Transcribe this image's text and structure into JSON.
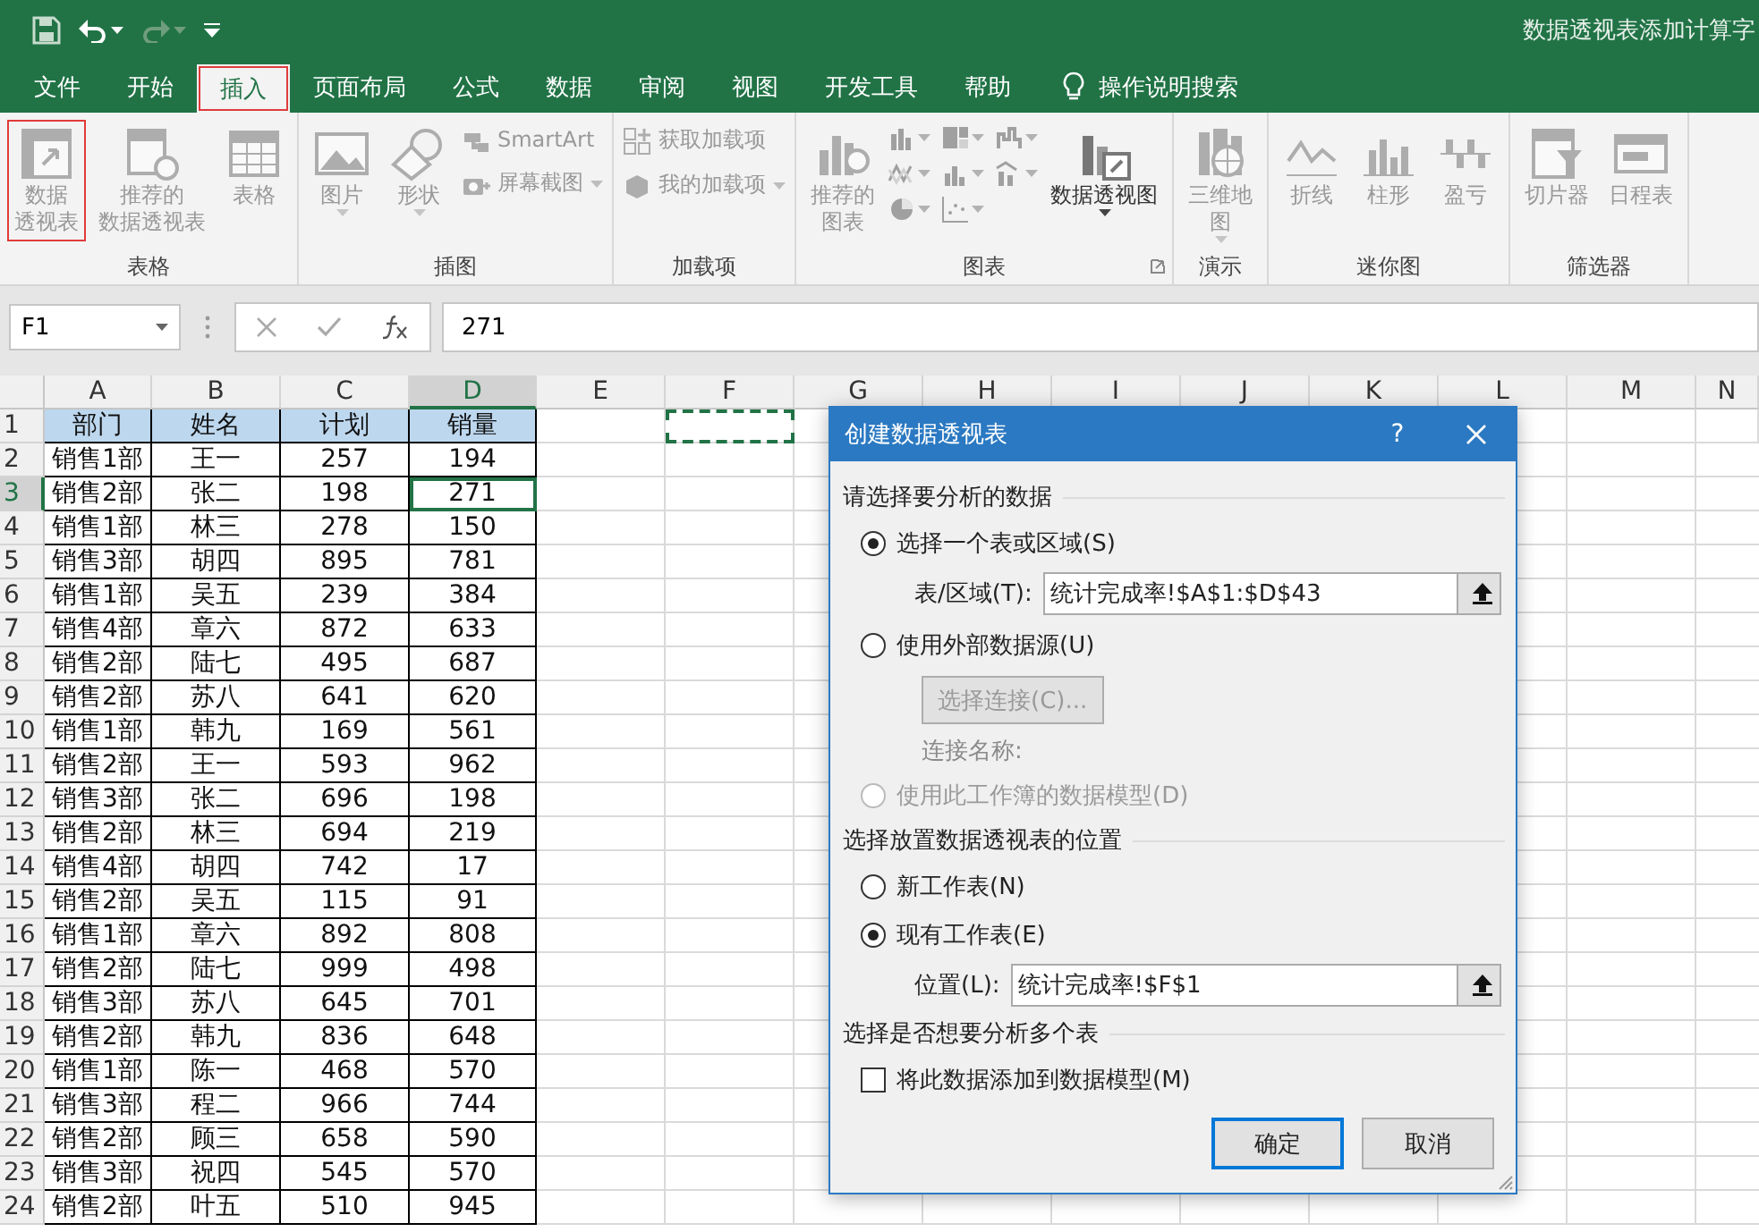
{
  "title_bar": {
    "title": "数据透视表添加计算字"
  },
  "ribbon_tabs": [
    {
      "label": "文件",
      "selected": false
    },
    {
      "label": "开始",
      "selected": false
    },
    {
      "label": "插入",
      "selected": true
    },
    {
      "label": "页面布局",
      "selected": false
    },
    {
      "label": "公式",
      "selected": false
    },
    {
      "label": "数据",
      "selected": false
    },
    {
      "label": "审阅",
      "selected": false
    },
    {
      "label": "视图",
      "selected": false
    },
    {
      "label": "开发工具",
      "selected": false
    },
    {
      "label": "帮助",
      "selected": false
    }
  ],
  "tell_me": "操作说明搜索",
  "ribbon_groups": [
    {
      "label": "表格",
      "items": [
        {
          "kind": "large",
          "lines": [
            "数据",
            "透视表"
          ],
          "highlighted": true,
          "disabled": true,
          "dropdown": false
        },
        {
          "kind": "large",
          "lines": [
            "推荐的",
            "数据透视表"
          ],
          "highlighted": false,
          "disabled": true,
          "dropdown": false
        },
        {
          "kind": "large",
          "lines": [
            "表格"
          ],
          "highlighted": false,
          "disabled": true,
          "dropdown": false
        }
      ]
    },
    {
      "label": "插图",
      "items": [
        {
          "kind": "large",
          "lines": [
            "图片"
          ],
          "highlighted": false,
          "disabled": true,
          "dropdown": true
        },
        {
          "kind": "large",
          "lines": [
            "形状"
          ],
          "highlighted": false,
          "disabled": true,
          "dropdown": true
        },
        {
          "kind": "small",
          "lines": [
            "SmartArt"
          ],
          "highlighted": false,
          "disabled": true,
          "dropdown": false
        },
        {
          "kind": "small",
          "lines": [
            "屏幕截图"
          ],
          "highlighted": false,
          "disabled": true,
          "dropdown": true
        }
      ]
    },
    {
      "label": "加载项",
      "items": [
        {
          "kind": "small",
          "lines": [
            "获取加载项"
          ],
          "highlighted": false,
          "disabled": true,
          "dropdown": false
        },
        {
          "kind": "small",
          "lines": [
            "我的加载项"
          ],
          "highlighted": false,
          "disabled": true,
          "dropdown": true
        }
      ]
    },
    {
      "label": "图表",
      "items": [
        {
          "kind": "large",
          "lines": [
            "推荐的",
            "图表"
          ],
          "highlighted": false,
          "disabled": true,
          "dropdown": false
        },
        {
          "kind": "gallery",
          "highlighted": false,
          "disabled": true,
          "dropdown": true
        },
        {
          "kind": "large",
          "lines": [
            "数据透视图"
          ],
          "highlighted": false,
          "disabled": false,
          "dropdown": true
        },
        {
          "kind": "launcher",
          "highlighted": false,
          "disabled": false,
          "dropdown": false
        }
      ]
    },
    {
      "label": "演示",
      "items": [
        {
          "kind": "large",
          "lines": [
            "三维地",
            "图"
          ],
          "highlighted": false,
          "disabled": true,
          "dropdown": true
        }
      ]
    },
    {
      "label": "迷你图",
      "items": [
        {
          "kind": "large",
          "lines": [
            "折线"
          ],
          "highlighted": false,
          "disabled": true,
          "dropdown": false
        },
        {
          "kind": "large",
          "lines": [
            "柱形"
          ],
          "highlighted": false,
          "disabled": true,
          "dropdown": false
        },
        {
          "kind": "large",
          "lines": [
            "盈亏"
          ],
          "highlighted": false,
          "disabled": true,
          "dropdown": false
        }
      ]
    },
    {
      "label": "筛选器",
      "items": [
        {
          "kind": "large",
          "lines": [
            "切片器"
          ],
          "highlighted": false,
          "disabled": true,
          "dropdown": false
        },
        {
          "kind": "large",
          "lines": [
            "日程表"
          ],
          "highlighted": false,
          "disabled": true,
          "dropdown": false
        }
      ]
    }
  ],
  "formula_bar": {
    "name_box": "F1",
    "value": "271"
  },
  "sheet": {
    "columns": [
      {
        "label": "A",
        "selected": false,
        "marquee": false
      },
      {
        "label": "B",
        "selected": false,
        "marquee": false
      },
      {
        "label": "C",
        "selected": false,
        "marquee": false
      },
      {
        "label": "D",
        "selected": true,
        "marquee": false
      },
      {
        "label": "E",
        "selected": false,
        "marquee": false
      },
      {
        "label": "F",
        "selected": false,
        "marquee": true
      },
      {
        "label": "G",
        "selected": false,
        "marquee": false
      },
      {
        "label": "H",
        "selected": false,
        "marquee": false
      },
      {
        "label": "I",
        "selected": false,
        "marquee": false
      },
      {
        "label": "J",
        "selected": false,
        "marquee": false
      },
      {
        "label": "K",
        "selected": false,
        "marquee": false
      },
      {
        "label": "L",
        "selected": false,
        "marquee": false
      },
      {
        "label": "M",
        "selected": false,
        "marquee": false
      },
      {
        "label": "N",
        "selected": false,
        "marquee": false
      }
    ],
    "rows": [
      {
        "header": "1",
        "kind": "header",
        "selected": false,
        "cells": [
          "部门",
          "姓名",
          "计划",
          "销量"
        ]
      },
      {
        "header": "2",
        "kind": "data",
        "selected": false,
        "cells": [
          "销售1部",
          "王一",
          "257",
          "194"
        ]
      },
      {
        "header": "3",
        "kind": "data",
        "selected": true,
        "cells": [
          "销售2部",
          "张二",
          "198",
          "271"
        ]
      },
      {
        "header": "4",
        "kind": "data",
        "selected": false,
        "cells": [
          "销售1部",
          "林三",
          "278",
          "150"
        ]
      },
      {
        "header": "5",
        "kind": "data",
        "selected": false,
        "cells": [
          "销售3部",
          "胡四",
          "895",
          "781"
        ]
      },
      {
        "header": "6",
        "kind": "data",
        "selected": false,
        "cells": [
          "销售1部",
          "吴五",
          "239",
          "384"
        ]
      },
      {
        "header": "7",
        "kind": "data",
        "selected": false,
        "cells": [
          "销售4部",
          "章六",
          "872",
          "633"
        ]
      },
      {
        "header": "8",
        "kind": "data",
        "selected": false,
        "cells": [
          "销售2部",
          "陆七",
          "495",
          "687"
        ]
      },
      {
        "header": "9",
        "kind": "data",
        "selected": false,
        "cells": [
          "销售2部",
          "苏八",
          "641",
          "620"
        ]
      },
      {
        "header": "10",
        "kind": "data",
        "selected": false,
        "cells": [
          "销售1部",
          "韩九",
          "169",
          "561"
        ]
      },
      {
        "header": "11",
        "kind": "data",
        "selected": false,
        "cells": [
          "销售2部",
          "王一",
          "593",
          "962"
        ]
      },
      {
        "header": "12",
        "kind": "data",
        "selected": false,
        "cells": [
          "销售3部",
          "张二",
          "696",
          "198"
        ]
      },
      {
        "header": "13",
        "kind": "data",
        "selected": false,
        "cells": [
          "销售2部",
          "林三",
          "694",
          "219"
        ]
      },
      {
        "header": "14",
        "kind": "data",
        "selected": false,
        "cells": [
          "销售4部",
          "胡四",
          "742",
          "17"
        ]
      },
      {
        "header": "15",
        "kind": "data",
        "selected": false,
        "cells": [
          "销售2部",
          "吴五",
          "115",
          "91"
        ]
      },
      {
        "header": "16",
        "kind": "data",
        "selected": false,
        "cells": [
          "销售1部",
          "章六",
          "892",
          "808"
        ]
      },
      {
        "header": "17",
        "kind": "data",
        "selected": false,
        "cells": [
          "销售2部",
          "陆七",
          "999",
          "498"
        ]
      },
      {
        "header": "18",
        "kind": "data",
        "selected": false,
        "cells": [
          "销售3部",
          "苏八",
          "645",
          "701"
        ]
      },
      {
        "header": "19",
        "kind": "data",
        "selected": false,
        "cells": [
          "销售2部",
          "韩九",
          "836",
          "648"
        ]
      },
      {
        "header": "20",
        "kind": "data",
        "selected": false,
        "cells": [
          "销售1部",
          "陈一",
          "468",
          "570"
        ]
      },
      {
        "header": "21",
        "kind": "data",
        "selected": false,
        "cells": [
          "销售3部",
          "程二",
          "966",
          "744"
        ]
      },
      {
        "header": "22",
        "kind": "data",
        "selected": false,
        "cells": [
          "销售2部",
          "顾三",
          "658",
          "590"
        ]
      },
      {
        "header": "23",
        "kind": "data",
        "selected": false,
        "cells": [
          "销售3部",
          "祝四",
          "545",
          "570"
        ]
      },
      {
        "header": "24",
        "kind": "data",
        "selected": false,
        "cells": [
          "销售2部",
          "叶五",
          "510",
          "945"
        ]
      }
    ]
  },
  "dialog": {
    "title": "创建数据透视表",
    "help": "?",
    "sections": [
      {
        "heading": "请选择要分析的数据",
        "items": [
          {
            "kind": "radio",
            "label": "选择一个表或区域(S)",
            "selected": true,
            "disabled": false
          },
          {
            "kind": "field",
            "label": "表/区域(T):",
            "value": "统计完成率!$A$1:$D$43"
          },
          {
            "kind": "radio",
            "label": "使用外部数据源(U)",
            "selected": false,
            "disabled": false
          },
          {
            "kind": "button",
            "label": "选择连接(C)...",
            "disabled": true
          },
          {
            "kind": "note",
            "label": "连接名称:",
            "disabled": true
          },
          {
            "kind": "radio",
            "label": "使用此工作簿的数据模型(D)",
            "selected": false,
            "disabled": true
          }
        ]
      },
      {
        "heading": "选择放置数据透视表的位置",
        "items": [
          {
            "kind": "radio",
            "label": "新工作表(N)",
            "selected": false,
            "disabled": false
          },
          {
            "kind": "radio",
            "label": "现有工作表(E)",
            "selected": true,
            "disabled": false
          },
          {
            "kind": "field",
            "label": "位置(L):",
            "value": "统计完成率!$F$1"
          }
        ]
      },
      {
        "heading": "选择是否想要分析多个表",
        "items": [
          {
            "kind": "checkbox",
            "label": "将此数据添加到数据模型(M)",
            "checked": false,
            "disabled": false
          }
        ]
      }
    ],
    "buttons": [
      {
        "label": "确定",
        "default": true
      },
      {
        "label": "取消",
        "default": false
      }
    ]
  }
}
